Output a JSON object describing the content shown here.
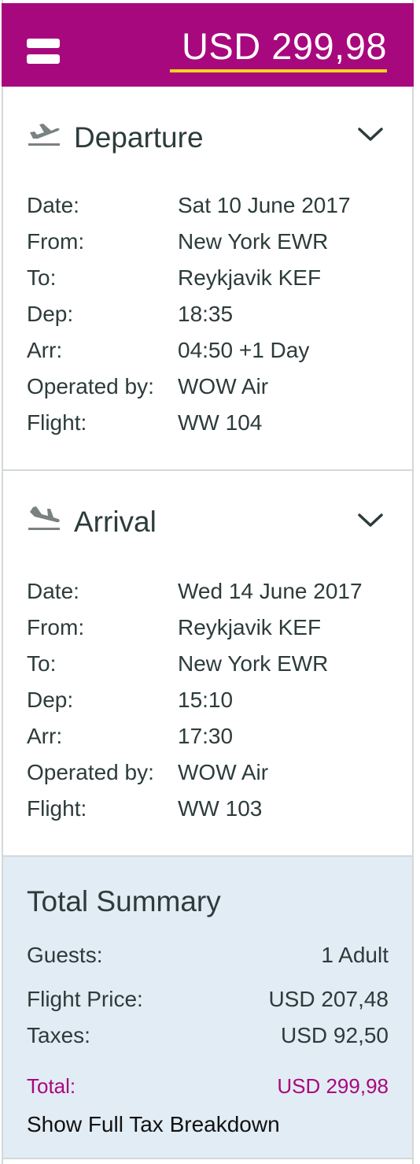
{
  "header": {
    "price": "USD 299,98",
    "accent_color": "#a8087e",
    "underline_color": "#f7d51c"
  },
  "departure": {
    "title": "Departure",
    "icon": "plane-takeoff-icon",
    "rows": [
      {
        "label": "Date:",
        "value": "Sat 10 June 2017"
      },
      {
        "label": "From:",
        "value": "New York EWR"
      },
      {
        "label": "To:",
        "value": "Reykjavik KEF"
      },
      {
        "label": "Dep:",
        "value": "18:35"
      },
      {
        "label": "Arr:",
        "value": "04:50 +1 Day"
      },
      {
        "label": "Operated by:",
        "value": "WOW Air"
      },
      {
        "label": "Flight:",
        "value": "WW 104"
      }
    ]
  },
  "arrival": {
    "title": "Arrival",
    "icon": "plane-landing-icon",
    "rows": [
      {
        "label": "Date:",
        "value": "Wed 14 June 2017"
      },
      {
        "label": "From:",
        "value": "Reykjavik KEF"
      },
      {
        "label": "To:",
        "value": "New York EWR"
      },
      {
        "label": "Dep:",
        "value": "15:10"
      },
      {
        "label": "Arr:",
        "value": "17:30"
      },
      {
        "label": "Operated by:",
        "value": "WOW Air"
      },
      {
        "label": "Flight:",
        "value": "WW 103"
      }
    ]
  },
  "summary": {
    "title": "Total Summary",
    "guests_label": "Guests:",
    "guests_value": "1 Adult",
    "flight_price_label": "Flight Price:",
    "flight_price_value": "USD 207,48",
    "taxes_label": "Taxes:",
    "taxes_value": "USD 92,50",
    "total_label": "Total:",
    "total_value": "USD 299,98",
    "tax_link": "Show Full Tax Breakdown",
    "background_color": "#e2ecf5"
  }
}
